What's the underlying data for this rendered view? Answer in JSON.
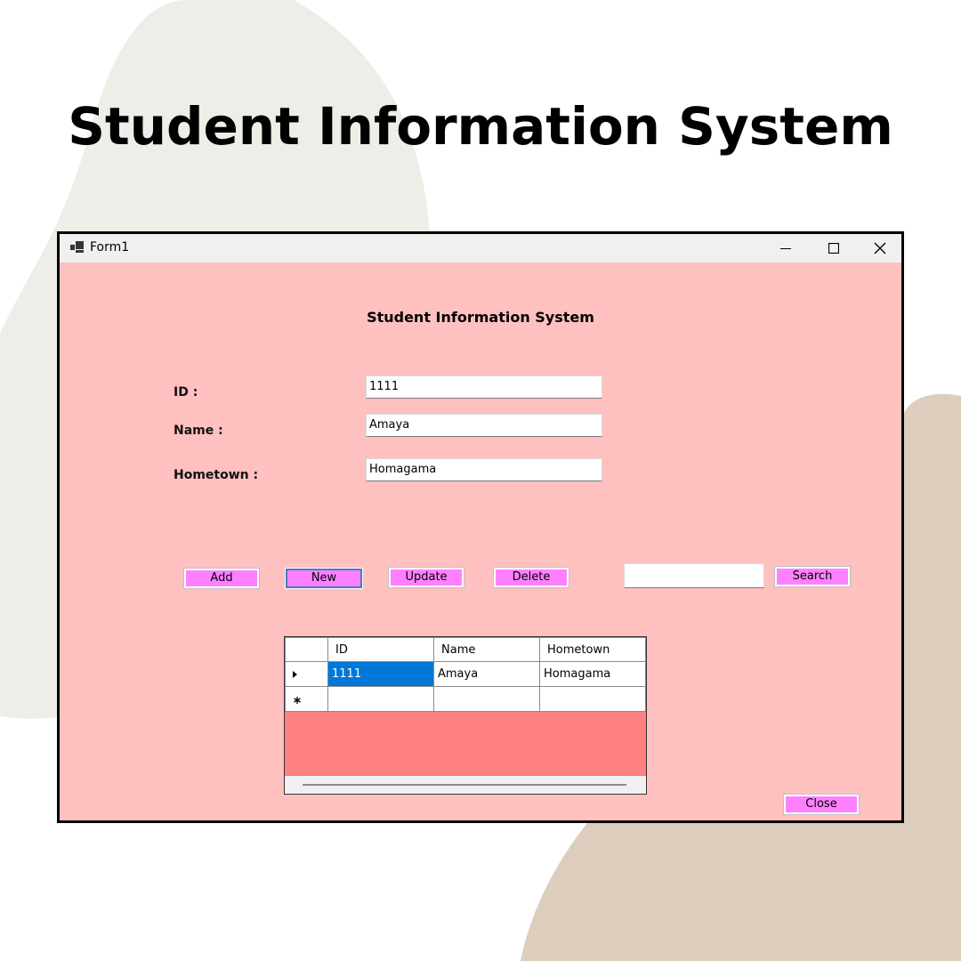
{
  "poster": {
    "title": "Student Information System"
  },
  "colors": {
    "form_bg": "#ffc0c0",
    "button_bg": "#ff80ff",
    "grid_bg": "#ff8080",
    "selection": "#0078d7"
  },
  "window": {
    "title": "Form1",
    "icons": {
      "app": "form-app-icon",
      "minimize": "minimize-icon",
      "maximize": "maximize-icon",
      "close": "close-icon"
    }
  },
  "form": {
    "heading": "Student Information System",
    "fields": {
      "id": {
        "label": "ID :",
        "value": "1111"
      },
      "name": {
        "label": "Name :",
        "value": "Amaya"
      },
      "hometown": {
        "label": "Hometown :",
        "value": "Homagama"
      }
    },
    "buttons": {
      "add": "Add",
      "new": "New",
      "update": "Update",
      "delete": "Delete",
      "search": "Search",
      "close": "Close"
    },
    "search": {
      "value": ""
    }
  },
  "grid": {
    "columns": [
      "ID",
      "Name",
      "Hometown"
    ],
    "rows": [
      {
        "indicator": "current-row-arrow",
        "cells": [
          "1111",
          "Amaya",
          "Homagama"
        ]
      }
    ],
    "new_row_indicator": "new-row-asterisk"
  }
}
